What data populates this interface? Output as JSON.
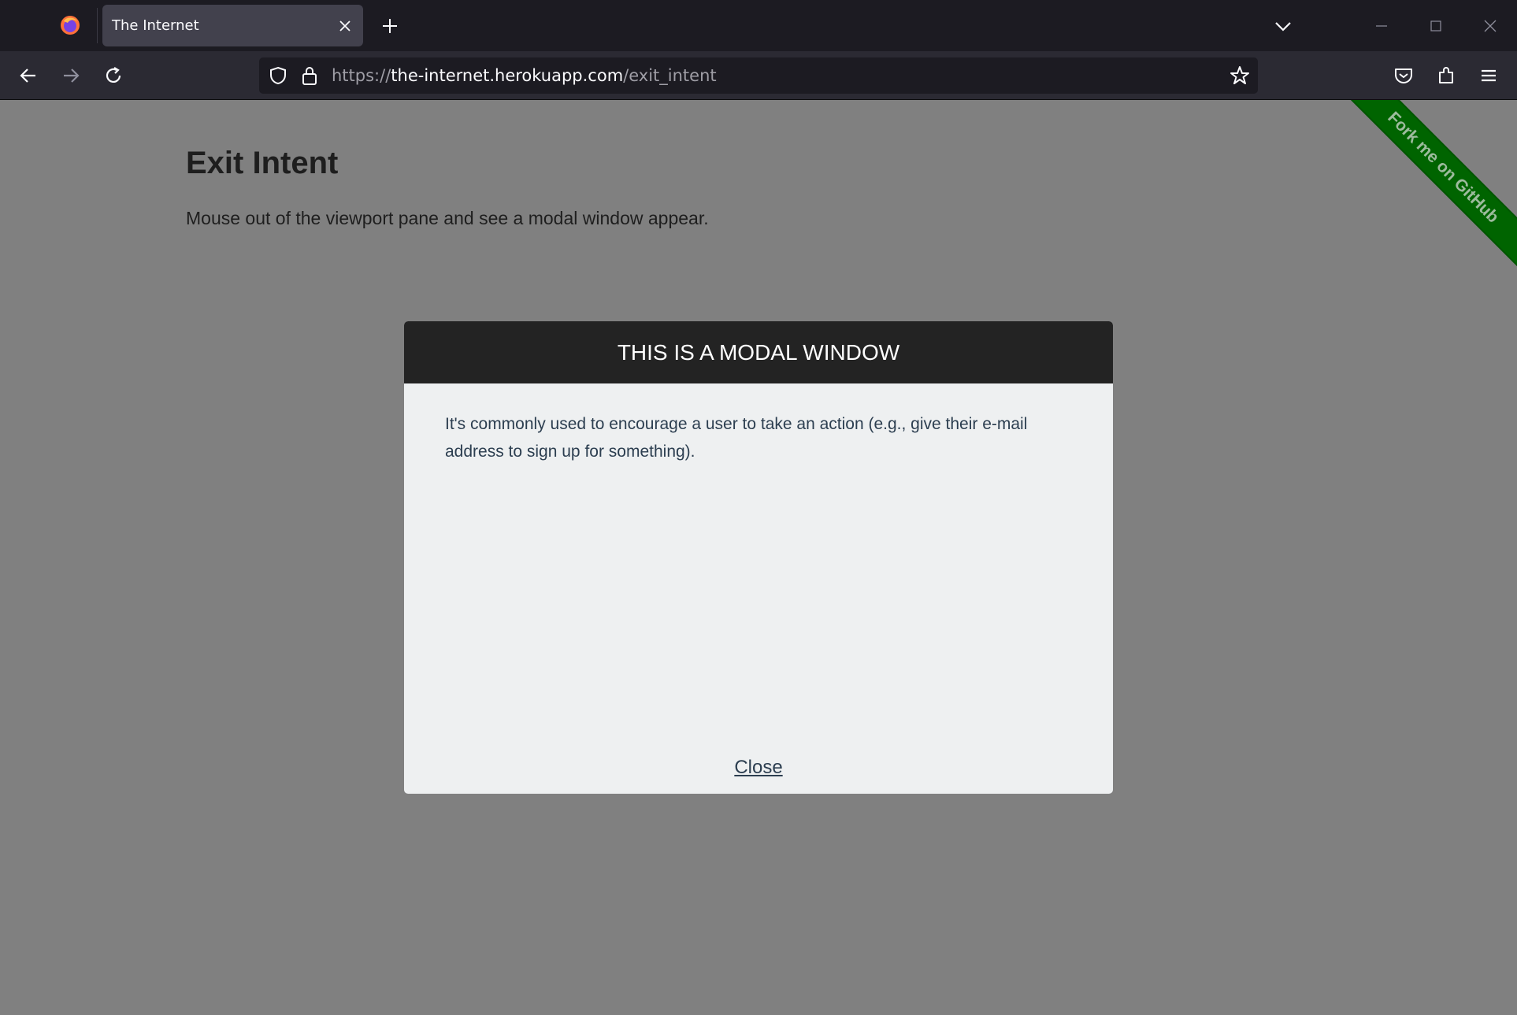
{
  "browser": {
    "tab_title": "The Internet",
    "url_scheme": "https://",
    "url_host": "the-internet.herokuapp.com",
    "url_path": "/exit_intent"
  },
  "page": {
    "title": "Exit Intent",
    "description": "Mouse out of the viewport pane and see a modal window appear.",
    "ribbon_text": "Fork me on GitHub"
  },
  "modal": {
    "title": "THIS IS A MODAL WINDOW",
    "body": "It's commonly used to encourage a user to take an action (e.g., give their e-mail address to sign up for something).",
    "close_label": "Close"
  },
  "colors": {
    "overlay": "#808080",
    "modal_header": "#232323",
    "modal_body": "#eef0f1",
    "ribbon": "#006400",
    "text": "#2c3e50"
  },
  "icons": [
    "firefox-icon",
    "close-icon",
    "plus-icon",
    "chevron-down-icon",
    "minimize-icon",
    "maximize-icon",
    "back-icon",
    "forward-icon",
    "reload-icon",
    "shield-icon",
    "lock-icon",
    "star-icon",
    "pocket-icon",
    "extensions-icon",
    "menu-icon"
  ]
}
